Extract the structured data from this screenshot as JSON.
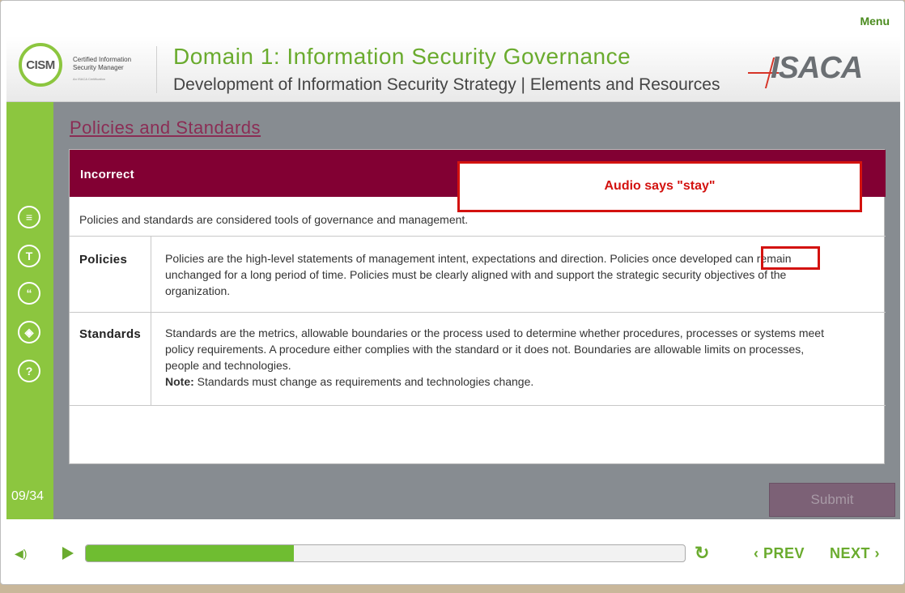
{
  "top": {
    "menu_label": "Menu"
  },
  "header": {
    "logo_text": "CISM",
    "logo_line1": "Certified Information",
    "logo_line2": "Security Manager",
    "logo_sub": "An ISACA Certification",
    "title": "Domain 1: Information Security Governance",
    "subtitle": "Development of Information Security Strategy | Elements and Resources",
    "brand": "ISACA"
  },
  "sidebar": {
    "icons": [
      {
        "name": "notes-icon",
        "glyph": "≡"
      },
      {
        "name": "transcript-icon",
        "glyph": "T"
      },
      {
        "name": "quote-icon",
        "glyph": "“"
      },
      {
        "name": "resources-icon",
        "glyph": "◈"
      },
      {
        "name": "help-icon",
        "glyph": "?"
      }
    ],
    "page_count": "09/34"
  },
  "content": {
    "title": "Policies and Standards",
    "feedback": "Incorrect",
    "intro": "Policies and standards are considered tools of governance and management.",
    "rows": [
      {
        "term": "Policies",
        "definition": "Policies are the high-level statements of management intent, expectations and direction. Policies once developed can remain unchanged for a long period of time. Policies must be clearly aligned with and support the strategic security objectives of the organization."
      },
      {
        "term": "Standards",
        "definition": "Standards are the metrics, allowable boundaries or the process used to determine whether procedures, processes or systems meet policy requirements. A procedure either complies with the standard or it does not. Boundaries are allowable limits on processes, people and technologies.",
        "note_label": "Note:",
        "note_text": "Standards must change as requirements and technologies change."
      }
    ],
    "submit_label": "Submit"
  },
  "annotation": {
    "callout_text": "Audio says \"stay\""
  },
  "player": {
    "progress_fraction": 0.347,
    "prev_label": "PREV",
    "next_label": "NEXT"
  },
  "colors": {
    "accent_green": "#8cc63f",
    "feedback_bg": "#820033",
    "annotation_red": "#d3120f"
  }
}
